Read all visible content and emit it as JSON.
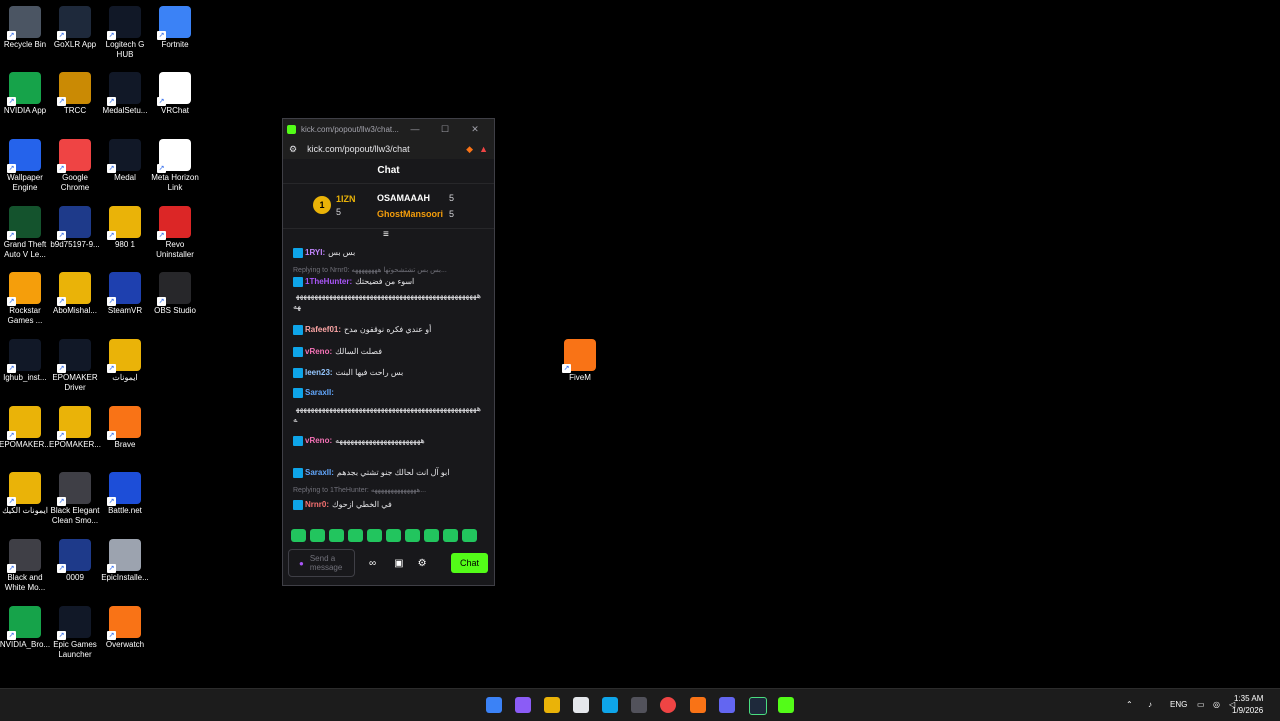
{
  "desktop": {
    "icons": [
      {
        "label": "Recycle Bin",
        "icon": "recycle-bin-icon",
        "color": "#4b5563"
      },
      {
        "label": "GoXLR App",
        "icon": "goxlr-icon",
        "color": "#1e293b"
      },
      {
        "label": "Logitech G HUB",
        "icon": "logitech-icon",
        "color": "#111827"
      },
      {
        "label": "Fortnite",
        "icon": "fortnite-icon",
        "color": "#3b82f6"
      },
      {
        "label": "NVIDIA App",
        "icon": "nvidia-icon",
        "color": "#16a34a"
      },
      {
        "label": "TRCC",
        "icon": "trcc-icon",
        "color": "#ca8a04"
      },
      {
        "label": "MedalSetu...",
        "icon": "medal-icon",
        "color": "#111827"
      },
      {
        "label": "VRChat",
        "icon": "vrchat-icon",
        "color": "#ffffff"
      },
      {
        "label": "Wallpaper Engine",
        "icon": "wallpaper-engine-icon",
        "color": "#2563eb"
      },
      {
        "label": "Google Chrome",
        "icon": "chrome-icon",
        "color": "#ef4444"
      },
      {
        "label": "Medal",
        "icon": "medal-icon",
        "color": "#111827"
      },
      {
        "label": "Meta Horizon Link",
        "icon": "meta-icon",
        "color": "#ffffff"
      },
      {
        "label": "Grand Theft Auto V Le...",
        "icon": "gta-icon",
        "color": "#14532d"
      },
      {
        "label": "b9d75197-9...",
        "icon": "image-icon",
        "color": "#1e3a8a"
      },
      {
        "label": "980 1",
        "icon": "folder-icon",
        "color": "#eab308"
      },
      {
        "label": "Revo Uninstaller",
        "icon": "revo-icon",
        "color": "#dc2626"
      },
      {
        "label": "Rockstar Games ...",
        "icon": "rockstar-icon",
        "color": "#f59e0b"
      },
      {
        "label": "AboMishal...",
        "icon": "folder-icon",
        "color": "#eab308"
      },
      {
        "label": "SteamVR",
        "icon": "steamvr-icon",
        "color": "#1e40af"
      },
      {
        "label": "OBS Studio",
        "icon": "obs-icon",
        "color": "#27272a"
      },
      {
        "label": "lghub_inst...",
        "icon": "logitech-icon",
        "color": "#111827"
      },
      {
        "label": "EPOMAKER Driver",
        "icon": "epomaker-icon",
        "color": "#111827"
      },
      {
        "label": "ايمونات",
        "icon": "folder-icon",
        "color": "#eab308"
      },
      {
        "label": "EPOMAKER...",
        "icon": "folder-icon",
        "color": "#eab308"
      },
      {
        "label": "EPOMAKER...",
        "icon": "folder-icon",
        "color": "#eab308"
      },
      {
        "label": "Brave",
        "icon": "brave-icon",
        "color": "#f97316"
      },
      {
        "label": "ايمونات الكيك",
        "icon": "folder-icon",
        "color": "#eab308"
      },
      {
        "label": "Black Elegant Clean Smo...",
        "icon": "video-icon",
        "color": "#3f3f46"
      },
      {
        "label": "Battle.net",
        "icon": "battlenet-icon",
        "color": "#1d4ed8"
      },
      {
        "label": "Black and White Mo...",
        "icon": "video-icon",
        "color": "#3f3f46"
      },
      {
        "label": "0009",
        "icon": "video-icon",
        "color": "#1e3a8a"
      },
      {
        "label": "EpicInstalle...",
        "icon": "disc-icon",
        "color": "#9ca3af"
      },
      {
        "label": "NVIDIA_Bro...",
        "icon": "nvidia-icon",
        "color": "#16a34a"
      },
      {
        "label": "Epic Games Launcher",
        "icon": "epic-icon",
        "color": "#111827"
      },
      {
        "label": "Overwatch",
        "icon": "overwatch-icon",
        "color": "#f97316"
      },
      {
        "label": "FiveM",
        "icon": "fivem-icon",
        "color": "#f97316"
      }
    ]
  },
  "popup": {
    "title": "kick.com/popout/llw3/chat...",
    "url": "kick.com/popout/llw3/chat",
    "min": "—",
    "max": "☐",
    "close": "✕",
    "header": "Chat",
    "leaderboard": {
      "rank": "1",
      "top_name": "1IZN",
      "top_count": "5",
      "users": [
        {
          "name": "OSAMAAAH",
          "count": "5"
        },
        {
          "name": "GhostMansoori",
          "count": "5"
        }
      ]
    },
    "messages": [
      {
        "user": "1RYI:",
        "text": "بس بس",
        "color": "#c084fc"
      },
      {
        "reply": "Replying to Nrnr0: بس بس تشتشحوتها ههههههههه..."
      },
      {
        "user": "1TheHunter:",
        "text": "اسوء من فضيحتك",
        "color": "#a855f7"
      },
      {
        "text": "هههههههههههههههههههههههههههههههههههههههههههههههههههه"
      },
      {
        "user": "Rafeef01:",
        "text": "أو عندي فكره نوقفون مدح",
        "color": "#fca5a5"
      },
      {
        "user": "vReno:",
        "text": "فصلت السالك",
        "color": "#f472b6"
      },
      {
        "user": "leen23:",
        "text": "بس راحت فيها البنت",
        "color": "#93c5fd"
      },
      {
        "user": "SaraxII:",
        "text": "",
        "color": "#60a5fa"
      },
      {
        "text": "ههههههههههههههههههههههههههههههههههههههههههههههههههه"
      },
      {
        "user": "vReno:",
        "text": "هههههههههههههههههههههههه",
        "color": "#f472b6"
      },
      {
        "user": "SaraxII:",
        "text": "ابو آل انت لحالك جنو تشتي بجدهم",
        "color": "#60a5fa"
      },
      {
        "reply": "Replying to 1TheHunter: ههههههههههههههه..."
      },
      {
        "user": "Nrnr0:",
        "text": "في الخطي ازحوك",
        "color": "#f87171"
      }
    ],
    "input_placeholder": "Send a message",
    "chat_button": "Chat"
  },
  "taskbar": {
    "lang": "ENG",
    "time": "1:35 AM",
    "date": "1/9/2026"
  }
}
